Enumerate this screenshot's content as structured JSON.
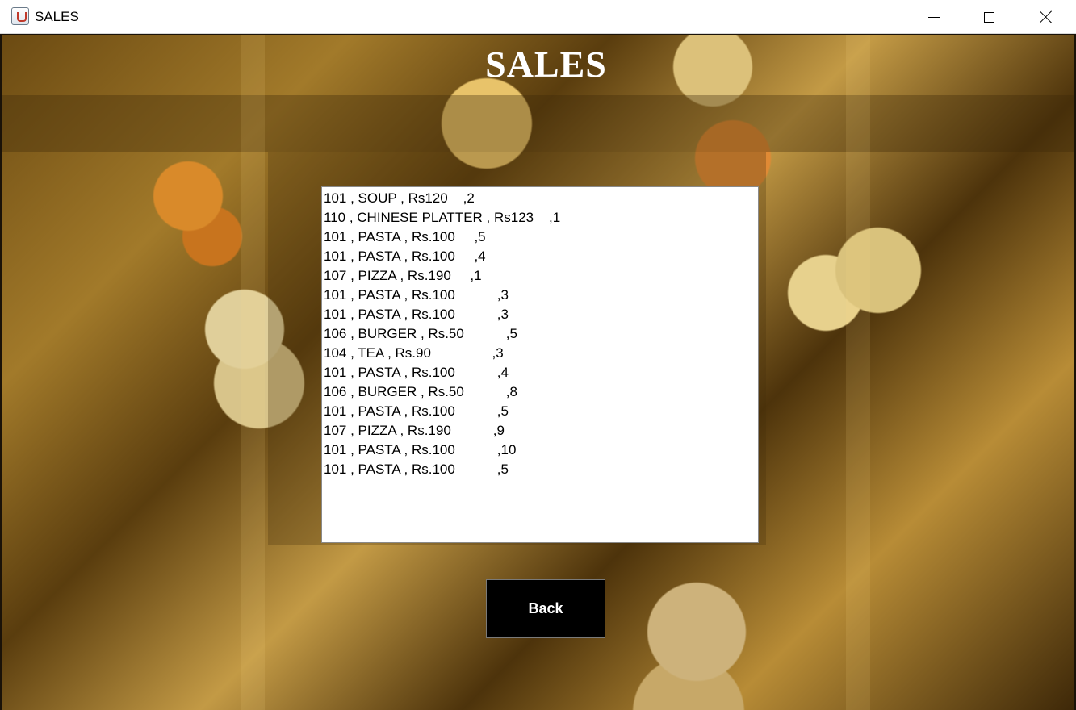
{
  "window": {
    "title": "SALES",
    "icon": "java-cup-icon",
    "controls": [
      "minimize-icon",
      "maximize-icon",
      "close-icon"
    ]
  },
  "header": {
    "title": "SALES"
  },
  "sales": {
    "rows": [
      "101 , SOUP , Rs120    ,2",
      "110 , CHINESE PLATTER , Rs123    ,1",
      "101 , PASTA , Rs.100     ,5",
      "101 , PASTA , Rs.100     ,4",
      "107 , PIZZA , Rs.190     ,1",
      "101 , PASTA , Rs.100           ,3",
      "101 , PASTA , Rs.100           ,3",
      "106 , BURGER , Rs.50           ,5",
      "104 , TEA , Rs.90                ,3",
      "101 , PASTA , Rs.100           ,4",
      "106 , BURGER , Rs.50           ,8",
      "101 , PASTA , Rs.100           ,5",
      "107 , PIZZA , Rs.190           ,9",
      "101 , PASTA , Rs.100           ,10",
      "101 , PASTA , Rs.100           ,5"
    ]
  },
  "actions": {
    "back_label": "Back"
  }
}
